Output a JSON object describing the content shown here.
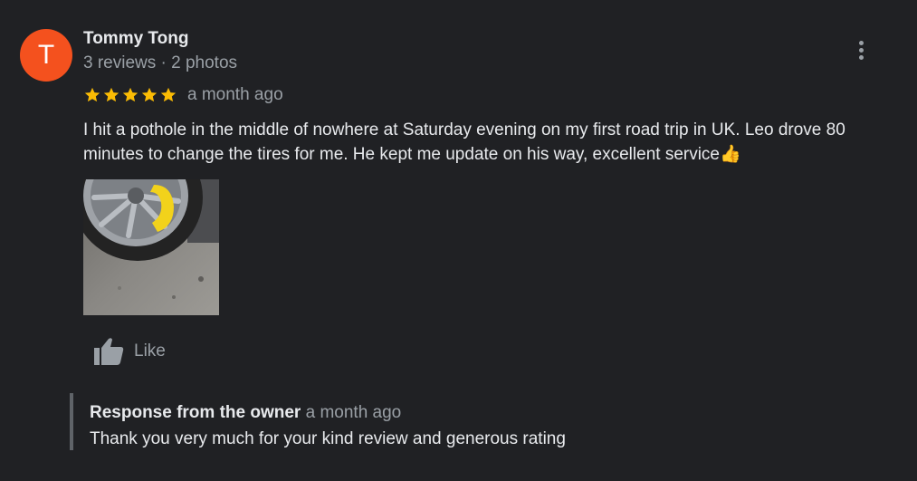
{
  "review": {
    "author": {
      "initial": "T",
      "name": "Tommy Tong",
      "meta": "3 reviews · 2 photos",
      "avatar_color": "#f4511e"
    },
    "rating": 5,
    "star_color": "#fbbc04",
    "date": "a month ago",
    "text": "I hit a pothole in the middle of nowhere at Saturday evening on my first road trip in UK. Leo drove 80 minutes to change the tires for me. He kept me update on his way, excellent service👍",
    "photos_shown": 1,
    "like_label": "Like",
    "more_icon": "more-vertical-icon"
  },
  "owner_response": {
    "title": "Response from the owner",
    "date": "a month ago",
    "text": "Thank you very much for your kind review and generous rating"
  }
}
